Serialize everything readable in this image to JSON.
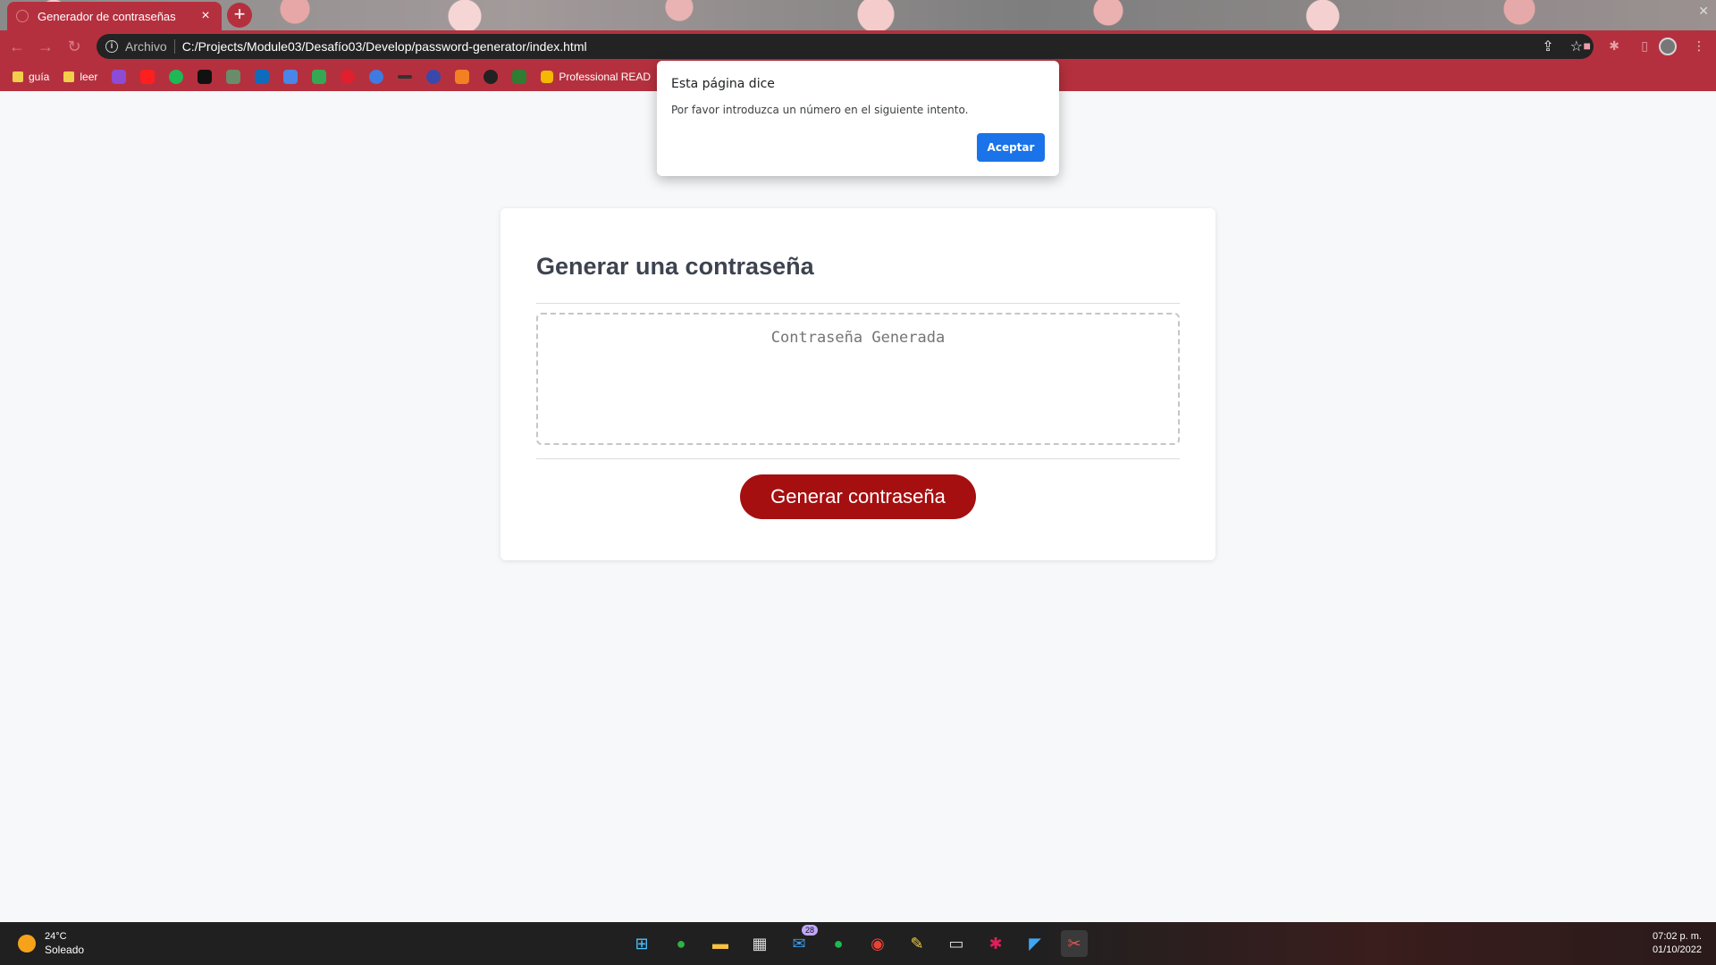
{
  "browser": {
    "tab_title": "Generador de contraseñas",
    "tab_close": "×",
    "new_tab": "+",
    "address_scheme": "Archivo",
    "address_url": "C:/Projects/Module03/Desafío03/Develop/password-generator/index.html",
    "bookmarks": [
      {
        "label": "guía",
        "kind": "folder"
      },
      {
        "label": "leer",
        "kind": "folder"
      },
      {
        "label": "Professional READ",
        "kind": "link"
      }
    ]
  },
  "page": {
    "heading": "Generar una contraseña",
    "password_placeholder": "Contraseña Generada",
    "generate_button": "Generar contraseña"
  },
  "dialog": {
    "title": "Esta página dice",
    "message": "Por favor introduzca un número en el siguiente intento.",
    "ok_button": "Aceptar"
  },
  "taskbar": {
    "temperature": "24°C",
    "condition": "Soleado",
    "mail_badge": "28",
    "time": "07:02 p. m.",
    "date": "01/10/2022"
  },
  "colors": {
    "brand_red": "#a50f10",
    "chrome_red": "#b5303e",
    "dialog_blue": "#1a73e8"
  }
}
